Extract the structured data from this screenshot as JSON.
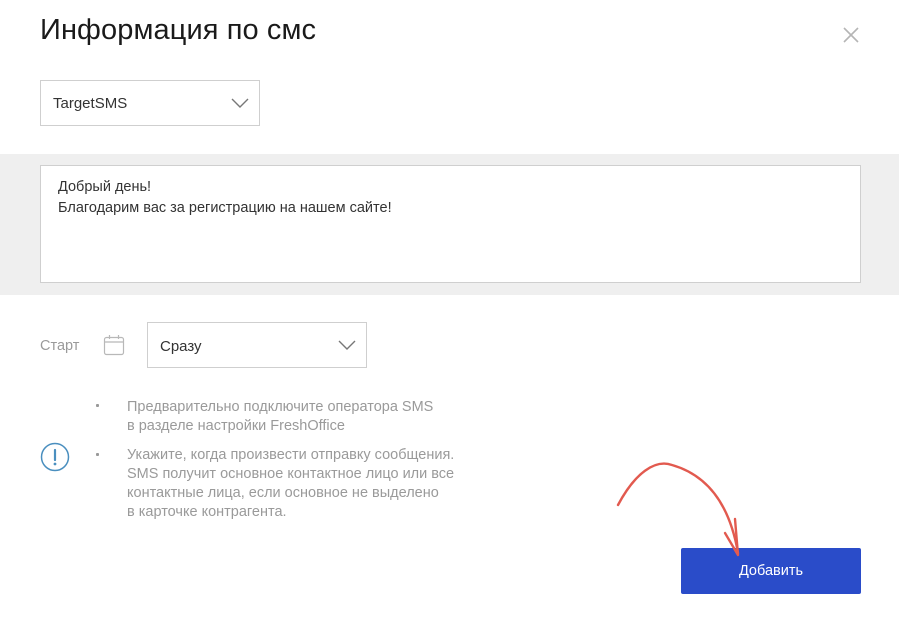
{
  "dialog": {
    "title": "Информация по смс",
    "close_icon": "close-icon"
  },
  "operator_select": {
    "value": "TargetSMS",
    "icon": "chevron-down-icon"
  },
  "message": {
    "lines": [
      "Добрый день!",
      "Благодарим вас за регистрацию на нашем сайте!"
    ]
  },
  "start": {
    "label": "Старт",
    "icon": "calendar-icon",
    "select_value": "Сразу"
  },
  "notes": {
    "icon": "info-icon",
    "items": [
      {
        "lines": [
          "Предварительно подключите оператора SMS",
          "в разделе настройки FreshOffice"
        ]
      },
      {
        "lines": [
          "Укажите, когда произвести отправку сообщения.",
          "SMS получит основное контактное лицо или все",
          "контактные лица, если основное не выделено",
          "в карточке контрагента."
        ]
      }
    ]
  },
  "actions": {
    "add_label": "Добавить"
  },
  "colors": {
    "primary_button": "#2a4cc9",
    "annotation_arrow": "#e25a4f",
    "band_background": "#efefef",
    "info_icon": "#4a8fbf"
  }
}
